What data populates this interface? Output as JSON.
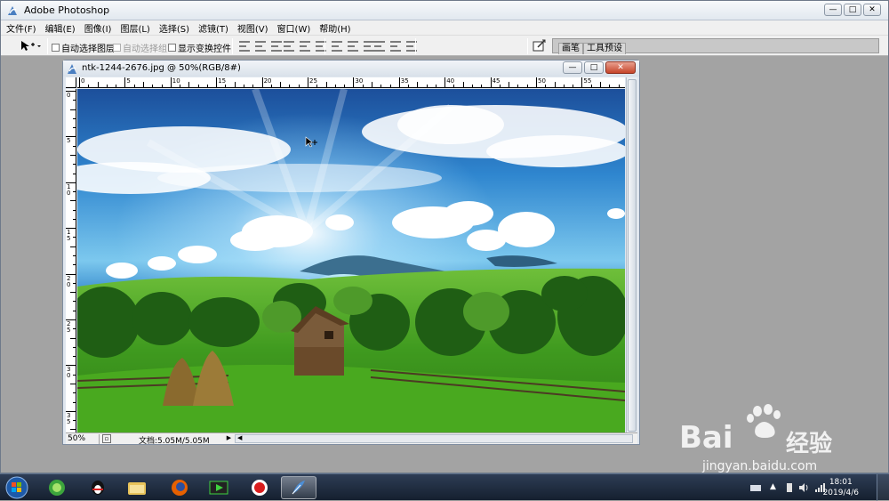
{
  "app": {
    "title": "Adobe Photoshop",
    "window_controls": [
      "minimize",
      "maximize",
      "close"
    ]
  },
  "menu": [
    "文件(F)",
    "编辑(E)",
    "图像(I)",
    "图层(L)",
    "选择(S)",
    "滤镜(T)",
    "视图(V)",
    "窗口(W)",
    "帮助(H)"
  ],
  "options": {
    "tool_icon": "move-tool-icon",
    "auto_select_layer": "自动选择图层",
    "auto_select_group": "自动选择组",
    "show_transform": "显示变换控件",
    "align_buttons": [
      "align-top",
      "align-vcenter",
      "align-bottom",
      "align-left",
      "align-hcenter",
      "align-right"
    ],
    "distribute_buttons": [
      "dist-top",
      "dist-vcenter",
      "dist-bottom",
      "dist-left",
      "dist-hcenter",
      "dist-right"
    ]
  },
  "palette_well": {
    "tabs": [
      "画笔",
      "工具预设"
    ]
  },
  "document": {
    "title": "ntk-1244-2676.jpg @ 50%(RGB/8#)",
    "ruler_h_labels": [
      "0",
      "5",
      "10",
      "15",
      "20",
      "25",
      "30",
      "35",
      "40",
      "45",
      "50",
      "55"
    ],
    "ruler_v_labels": [
      "0",
      "5",
      "10",
      "15",
      "20",
      "25",
      "30",
      "35"
    ],
    "status": {
      "zoom": "50%",
      "info": "文档:5.05M/5.05M"
    }
  },
  "taskbar": {
    "apps": [
      "360-browser",
      "qq",
      "file-explorer",
      "firefox",
      "media-player",
      "screen-recorder",
      "photoshop"
    ],
    "clock_time": "18:01",
    "clock_date": "2019/4/6"
  },
  "watermark": {
    "brand": "Bai",
    "brand_cn": "经验",
    "url": "jingyan.baidu.com"
  },
  "colors": {
    "sky_top": "#1a4f9c",
    "sky_mid": "#58b4e6",
    "grass": "#3f8f1e",
    "taskbar": "#1c2a3e"
  }
}
